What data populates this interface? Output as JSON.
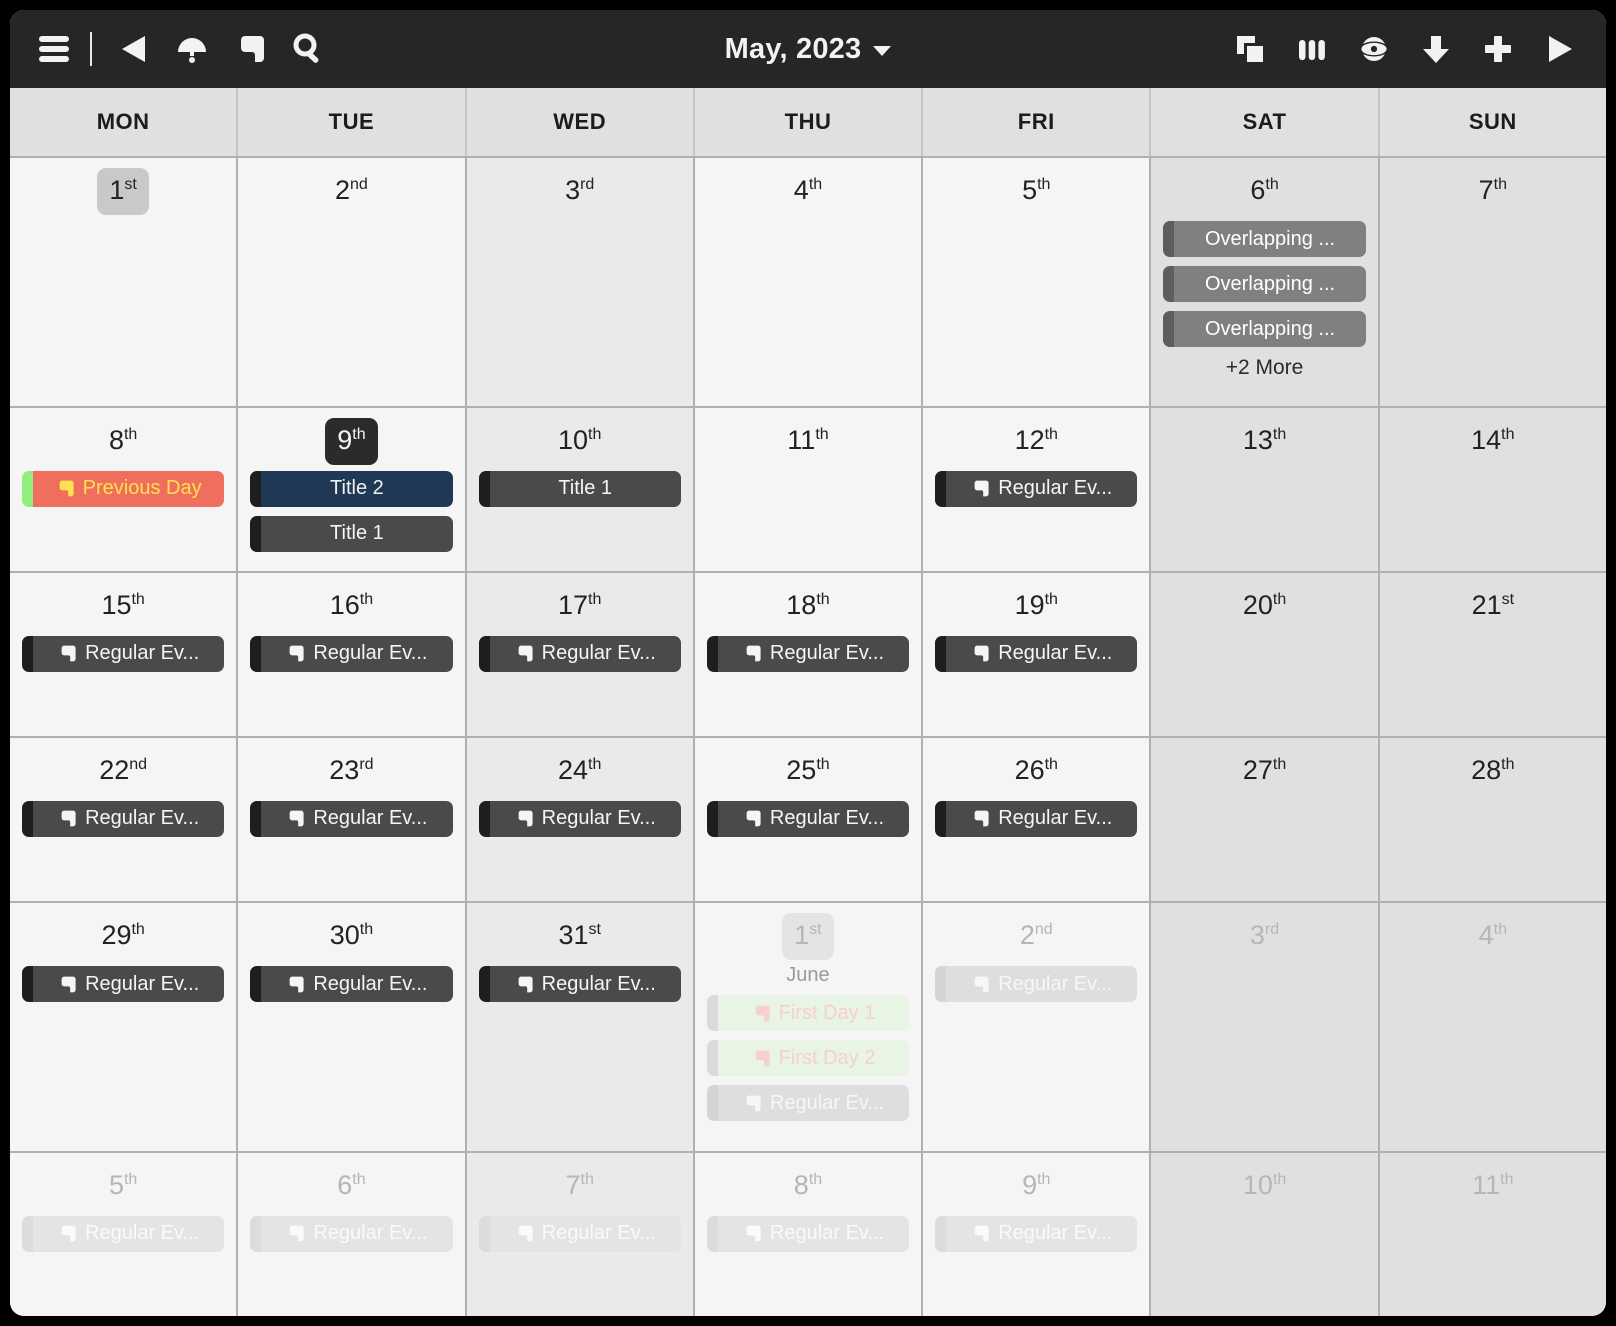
{
  "toolbar": {
    "left_buttons": [
      {
        "name": "menu-icon",
        "label": "Menu"
      },
      {
        "name": "previous-icon",
        "label": "Previous"
      },
      {
        "name": "today-icon",
        "label": "Today"
      },
      {
        "name": "event-icon",
        "label": "Events"
      },
      {
        "name": "search-icon",
        "label": "Search"
      }
    ],
    "title": "May, 2023",
    "title_caret": "chevron-down-icon",
    "right_buttons": [
      {
        "name": "layers-icon",
        "label": "Layers"
      },
      {
        "name": "columns-icon",
        "label": "Columns"
      },
      {
        "name": "eye-icon",
        "label": "Visibility"
      },
      {
        "name": "download-icon",
        "label": "Download"
      },
      {
        "name": "add-icon",
        "label": "Add"
      },
      {
        "name": "next-icon",
        "label": "Next"
      }
    ]
  },
  "day_headers": [
    "MON",
    "TUE",
    "WED",
    "THU",
    "FRI",
    "SAT",
    "SUN"
  ],
  "colors": {
    "toolbar_bg": "#262626",
    "header_bg": "#e0e0e0",
    "cell_bg": "#f5f5f5",
    "cell_tint": "#ebeaea",
    "weekend_bg": "#e0e0e0",
    "grid_line": "#b0b0b0",
    "event_dark": "#4a4a4a",
    "event_overlap": "#808080",
    "event_navy": "#1f3855",
    "event_prev_bg": "#ef6e5e",
    "event_prev_stripe": "#93ef7c",
    "event_prev_text": "#ffe14f",
    "event_firstday_bg": "#e8f4e4",
    "event_firstday_text": "#f6cfcf",
    "today_badge": "#c9c9c9",
    "selected_badge": "#2b2b2b"
  },
  "more_label": "+2 More",
  "weeks": [
    {
      "tall": true,
      "cells": [
        {
          "num": "1",
          "sup": "st",
          "badge": "today",
          "col": "mon",
          "events": []
        },
        {
          "num": "2",
          "sup": "nd",
          "col": "tue",
          "events": []
        },
        {
          "num": "3",
          "sup": "rd",
          "col": "wed",
          "events": []
        },
        {
          "num": "4",
          "sup": "th",
          "col": "thu",
          "events": []
        },
        {
          "num": "5",
          "sup": "th",
          "col": "fri",
          "events": []
        },
        {
          "num": "6",
          "sup": "th",
          "col": "sat",
          "more": "+2 More",
          "events": [
            {
              "title": "Overlapping ...",
              "style": "overlap",
              "icon": false
            },
            {
              "title": "Overlapping ...",
              "style": "overlap",
              "icon": false
            },
            {
              "title": "Overlapping ...",
              "style": "overlap",
              "icon": false
            }
          ]
        },
        {
          "num": "7",
          "sup": "th",
          "col": "sun",
          "events": []
        }
      ]
    },
    {
      "cells": [
        {
          "num": "8",
          "sup": "th",
          "col": "mon",
          "events": [
            {
              "title": "Previous Day",
              "style": "prev",
              "icon": true
            }
          ]
        },
        {
          "num": "9",
          "sup": "th",
          "badge": "selected",
          "col": "tue",
          "events": [
            {
              "title": "Title 2",
              "style": "navy",
              "icon": false
            },
            {
              "title": "Title 1",
              "style": "dark",
              "icon": false
            }
          ]
        },
        {
          "num": "10",
          "sup": "th",
          "col": "wed",
          "events": [
            {
              "title": "Title 1",
              "style": "dark",
              "icon": false
            }
          ]
        },
        {
          "num": "11",
          "sup": "th",
          "col": "thu",
          "events": []
        },
        {
          "num": "12",
          "sup": "th",
          "col": "fri",
          "events": [
            {
              "title": "Regular Ev...",
              "style": "dark",
              "icon": true
            }
          ]
        },
        {
          "num": "13",
          "sup": "th",
          "col": "sat",
          "events": []
        },
        {
          "num": "14",
          "sup": "th",
          "col": "sun",
          "events": []
        }
      ]
    },
    {
      "cells": [
        {
          "num": "15",
          "sup": "th",
          "col": "mon",
          "events": [
            {
              "title": "Regular Ev...",
              "style": "dark",
              "icon": true
            }
          ]
        },
        {
          "num": "16",
          "sup": "th",
          "col": "tue",
          "events": [
            {
              "title": "Regular Ev...",
              "style": "dark",
              "icon": true
            }
          ]
        },
        {
          "num": "17",
          "sup": "th",
          "col": "wed",
          "events": [
            {
              "title": "Regular Ev...",
              "style": "dark",
              "icon": true
            }
          ]
        },
        {
          "num": "18",
          "sup": "th",
          "col": "thu",
          "events": [
            {
              "title": "Regular Ev...",
              "style": "dark",
              "icon": true
            }
          ]
        },
        {
          "num": "19",
          "sup": "th",
          "col": "fri",
          "events": [
            {
              "title": "Regular Ev...",
              "style": "dark",
              "icon": true
            }
          ]
        },
        {
          "num": "20",
          "sup": "th",
          "col": "sat",
          "events": []
        },
        {
          "num": "21",
          "sup": "st",
          "col": "sun",
          "events": []
        }
      ]
    },
    {
      "cells": [
        {
          "num": "22",
          "sup": "nd",
          "col": "mon",
          "events": [
            {
              "title": "Regular Ev...",
              "style": "dark",
              "icon": true
            }
          ]
        },
        {
          "num": "23",
          "sup": "rd",
          "col": "tue",
          "events": [
            {
              "title": "Regular Ev...",
              "style": "dark",
              "icon": true
            }
          ]
        },
        {
          "num": "24",
          "sup": "th",
          "col": "wed",
          "events": [
            {
              "title": "Regular Ev...",
              "style": "dark",
              "icon": true
            }
          ]
        },
        {
          "num": "25",
          "sup": "th",
          "col": "thu",
          "events": [
            {
              "title": "Regular Ev...",
              "style": "dark",
              "icon": true
            }
          ]
        },
        {
          "num": "26",
          "sup": "th",
          "col": "fri",
          "events": [
            {
              "title": "Regular Ev...",
              "style": "dark",
              "icon": true
            }
          ]
        },
        {
          "num": "27",
          "sup": "th",
          "col": "sat",
          "events": []
        },
        {
          "num": "28",
          "sup": "th",
          "col": "sun",
          "events": []
        }
      ]
    },
    {
      "tall": true,
      "cells": [
        {
          "num": "29",
          "sup": "th",
          "col": "mon",
          "events": [
            {
              "title": "Regular Ev...",
              "style": "dark",
              "icon": true
            }
          ]
        },
        {
          "num": "30",
          "sup": "th",
          "col": "tue",
          "events": [
            {
              "title": "Regular Ev...",
              "style": "dark",
              "icon": true
            }
          ]
        },
        {
          "num": "31",
          "sup": "st",
          "col": "wed",
          "events": [
            {
              "title": "Regular Ev...",
              "style": "dark",
              "icon": true
            }
          ]
        },
        {
          "num": "1",
          "sup": "st",
          "badge": "today",
          "other": true,
          "month": "June",
          "col": "thu",
          "events": [
            {
              "title": "First Day 1",
              "style": "firstday",
              "icon": true,
              "fade": "faded"
            },
            {
              "title": "First Day 2",
              "style": "firstday",
              "icon": true,
              "fade": "faded"
            },
            {
              "title": "Regular Ev...",
              "style": "dark",
              "icon": true,
              "fade": "faded"
            }
          ]
        },
        {
          "num": "2",
          "sup": "nd",
          "other": true,
          "col": "fri",
          "events": [
            {
              "title": "Regular Ev...",
              "style": "dark",
              "icon": true,
              "fade": "faded"
            }
          ]
        },
        {
          "num": "3",
          "sup": "rd",
          "other": true,
          "col": "sat",
          "events": []
        },
        {
          "num": "4",
          "sup": "th",
          "other": true,
          "col": "sun",
          "events": []
        }
      ]
    },
    {
      "cells": [
        {
          "num": "5",
          "sup": "th",
          "other": true,
          "col": "mon",
          "events": [
            {
              "title": "Regular Ev...",
              "style": "dark",
              "icon": true,
              "fade": "faded2"
            }
          ]
        },
        {
          "num": "6",
          "sup": "th",
          "other": true,
          "col": "tue",
          "events": [
            {
              "title": "Regular Ev...",
              "style": "dark",
              "icon": true,
              "fade": "faded2"
            }
          ]
        },
        {
          "num": "7",
          "sup": "th",
          "other": true,
          "col": "wed",
          "events": [
            {
              "title": "Regular Ev...",
              "style": "dark",
              "icon": true,
              "fade": "faded2"
            }
          ]
        },
        {
          "num": "8",
          "sup": "th",
          "other": true,
          "col": "thu",
          "events": [
            {
              "title": "Regular Ev...",
              "style": "dark",
              "icon": true,
              "fade": "faded2"
            }
          ]
        },
        {
          "num": "9",
          "sup": "th",
          "other": true,
          "col": "fri",
          "events": [
            {
              "title": "Regular Ev...",
              "style": "dark",
              "icon": true,
              "fade": "faded2"
            }
          ]
        },
        {
          "num": "10",
          "sup": "th",
          "other": true,
          "col": "sat",
          "events": []
        },
        {
          "num": "11",
          "sup": "th",
          "other": true,
          "col": "sun",
          "events": []
        }
      ]
    }
  ]
}
